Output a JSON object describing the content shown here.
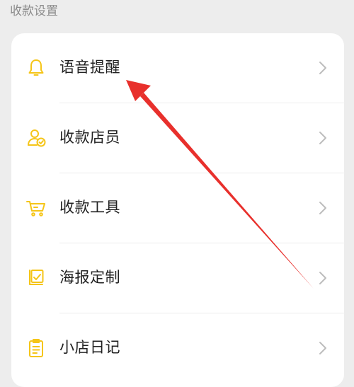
{
  "section": {
    "title": "收款设置"
  },
  "items": [
    {
      "label": "语音提醒",
      "icon": "bell-icon"
    },
    {
      "label": "收款店员",
      "icon": "staff-check-icon"
    },
    {
      "label": "收款工具",
      "icon": "cart-icon"
    },
    {
      "label": "海报定制",
      "icon": "poster-icon"
    },
    {
      "label": "小店日记",
      "icon": "clipboard-icon"
    }
  ],
  "colors": {
    "accent": "#f5c518",
    "annotation": "#e8302c",
    "chevron": "#bdbdbd"
  }
}
